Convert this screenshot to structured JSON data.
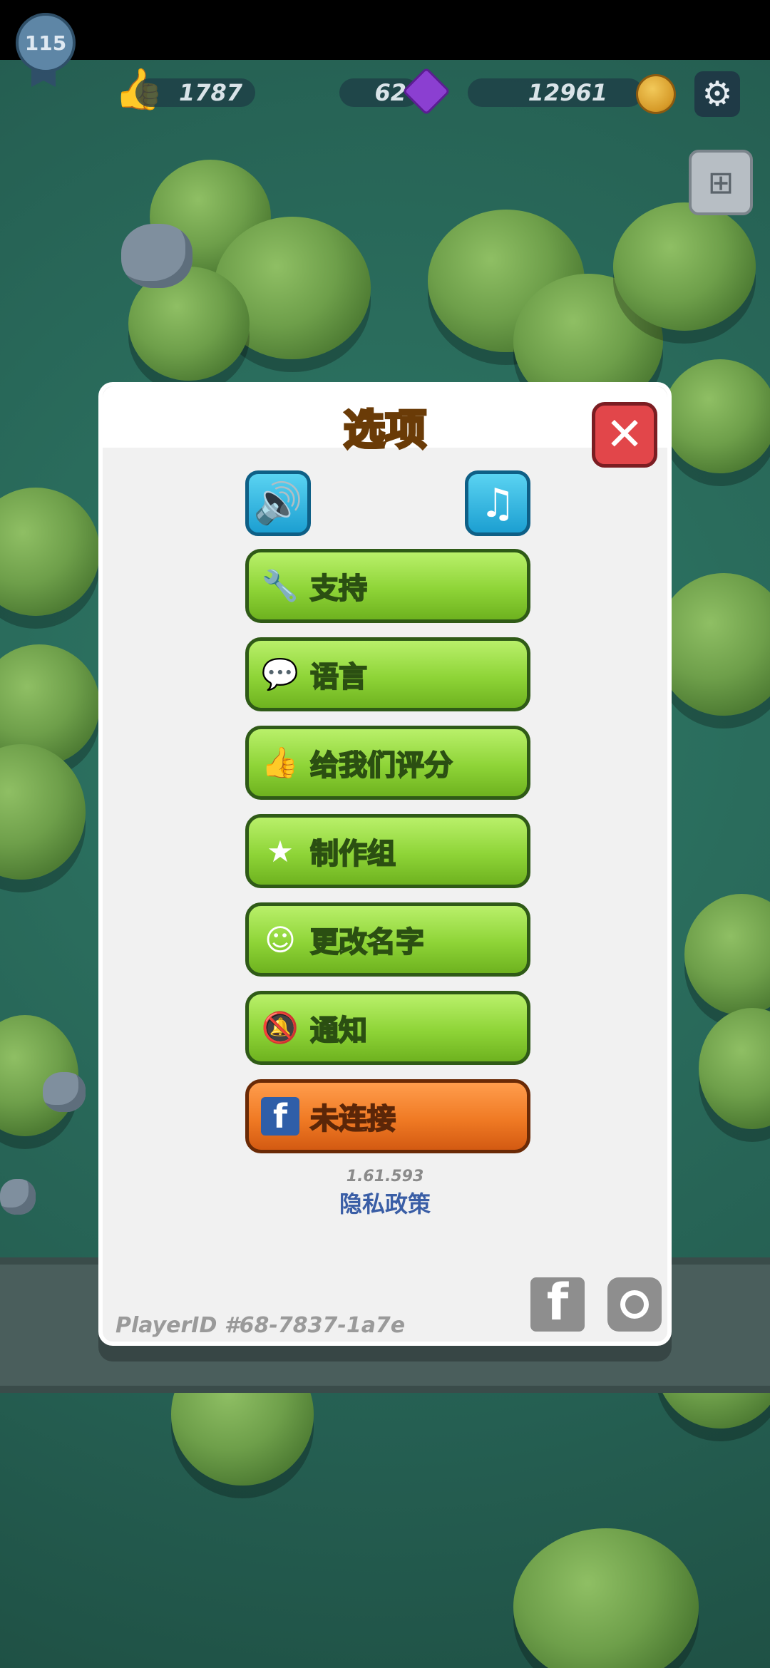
{
  "hud": {
    "level": "115",
    "likes": "1787",
    "gems": "62",
    "coins": "12961",
    "settings_icon": "gear-icon",
    "map_icon": "map-icon"
  },
  "dialog": {
    "title": "选项",
    "close_icon": "close-icon",
    "sound_icon": "speaker-icon",
    "music_icon": "music-note-icon",
    "menu": [
      {
        "label": "支持",
        "icon": "wrench-icon"
      },
      {
        "label": "语言",
        "icon": "chat-icon"
      },
      {
        "label": "给我们评分",
        "icon": "thumbs-up-icon"
      },
      {
        "label": "制作组",
        "icon": "star-icon"
      },
      {
        "label": "更改名字",
        "icon": "name-tag-icon"
      },
      {
        "label": "通知",
        "icon": "bell-muted-icon"
      },
      {
        "label": "未连接",
        "icon": "facebook-icon"
      }
    ],
    "version": "1.61.593",
    "privacy": "隐私政策",
    "player_id": "PlayerID #68-7837-1a7e"
  },
  "colors": {
    "green_button": "#8ed437",
    "orange_button": "#f07a24",
    "title": "#f3a11c",
    "close_button": "#e2464a",
    "icon_button": "#1c9fd1"
  }
}
